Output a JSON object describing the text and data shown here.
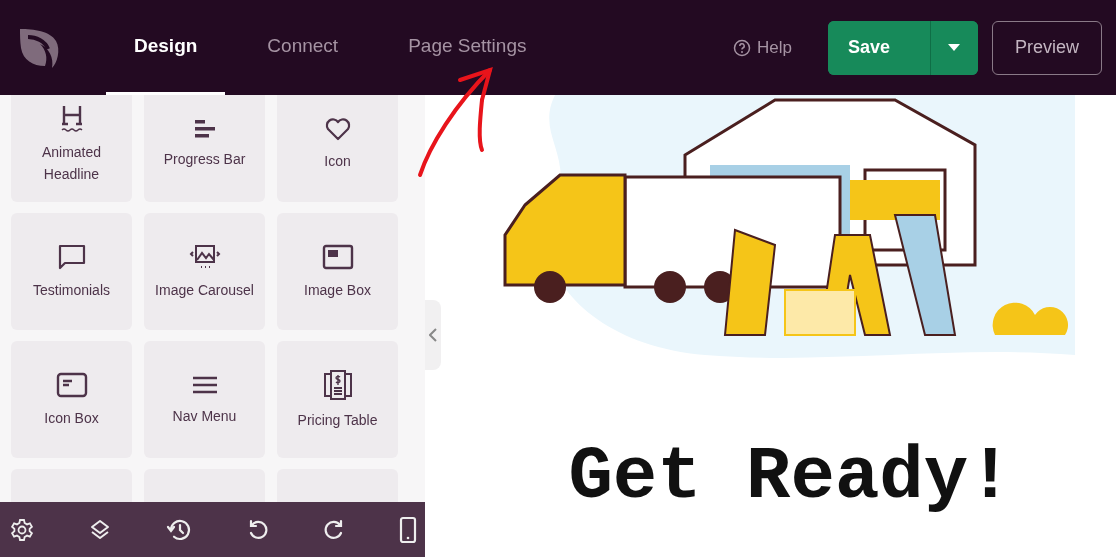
{
  "header": {
    "tabs": [
      {
        "label": "Design",
        "selected": true
      },
      {
        "label": "Connect",
        "selected": false
      },
      {
        "label": "Page Settings",
        "selected": false
      }
    ],
    "help": "Help",
    "save": "Save",
    "preview": "Preview"
  },
  "widgets": [
    {
      "label": "Animated Headline",
      "kind": "headline"
    },
    {
      "label": "Progress Bar",
      "kind": "bars"
    },
    {
      "label": "Icon",
      "kind": "heart"
    },
    {
      "label": "Testimonials",
      "kind": "chat"
    },
    {
      "label": "Image Carousel",
      "kind": "carousel"
    },
    {
      "label": "Image Box",
      "kind": "imagebox"
    },
    {
      "label": "Icon Box",
      "kind": "iconbox"
    },
    {
      "label": "Nav Menu",
      "kind": "menu"
    },
    {
      "label": "Pricing Table",
      "kind": "pricing"
    }
  ],
  "canvas": {
    "headline": "Get Ready!"
  }
}
